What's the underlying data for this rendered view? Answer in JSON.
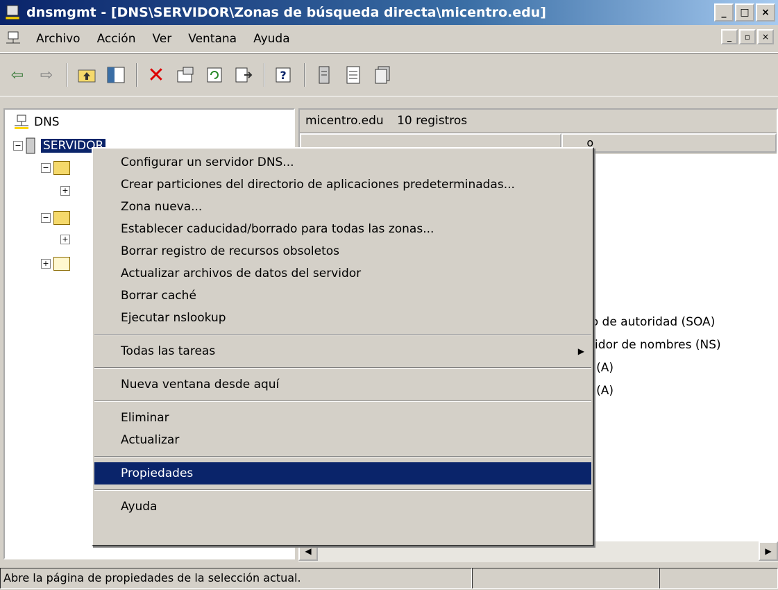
{
  "window": {
    "title": "dnsmgmt - [DNS\\SERVIDOR\\Zonas de búsqueda directa\\micentro.edu]",
    "controls": [
      "_",
      "□",
      "×"
    ]
  },
  "menubar": {
    "items": [
      "Archivo",
      "Acción",
      "Ver",
      "Ventana",
      "Ayuda"
    ],
    "mdi_controls": [
      "_",
      "▫",
      "×"
    ]
  },
  "toolbar": {
    "icons": [
      "back-arrow-icon",
      "forward-arrow-icon",
      "up-folder-icon",
      "show-hide-tree-icon",
      "delete-icon",
      "properties-icon",
      "refresh-icon",
      "export-list-icon",
      "help-icon",
      "server-icon",
      "record-icon",
      "zone-icon"
    ]
  },
  "tree": {
    "root": "DNS",
    "server": "SERVIDOR"
  },
  "list": {
    "header_zone": "micentro.edu",
    "header_count": "10 registros",
    "col_name_partial": "",
    "col_type_partial": "o",
    "rows": [
      "io de autoridad (SOA)",
      "vidor de nombres (NS)",
      "t (A)",
      "t (A)"
    ]
  },
  "context_menu": {
    "group1": [
      "Configurar un servidor DNS...",
      "Crear particiones del directorio de aplicaciones predeterminadas...",
      "Zona nueva...",
      "Establecer caducidad/borrado para todas las zonas...",
      "Borrar registro de recursos obsoletos",
      "Actualizar archivos de datos del servidor",
      "Borrar caché",
      "Ejecutar nslookup"
    ],
    "group2": [
      "Todas las tareas"
    ],
    "group3": [
      "Nueva ventana desde aquí"
    ],
    "group4": [
      "Eliminar",
      "Actualizar"
    ],
    "group5": [
      "Propiedades"
    ],
    "group6": [
      "Ayuda"
    ]
  },
  "statusbar": {
    "text": "Abre la página de propiedades de la selección actual."
  },
  "colors": {
    "selection": "#0a246a",
    "face": "#d4d0c8"
  }
}
